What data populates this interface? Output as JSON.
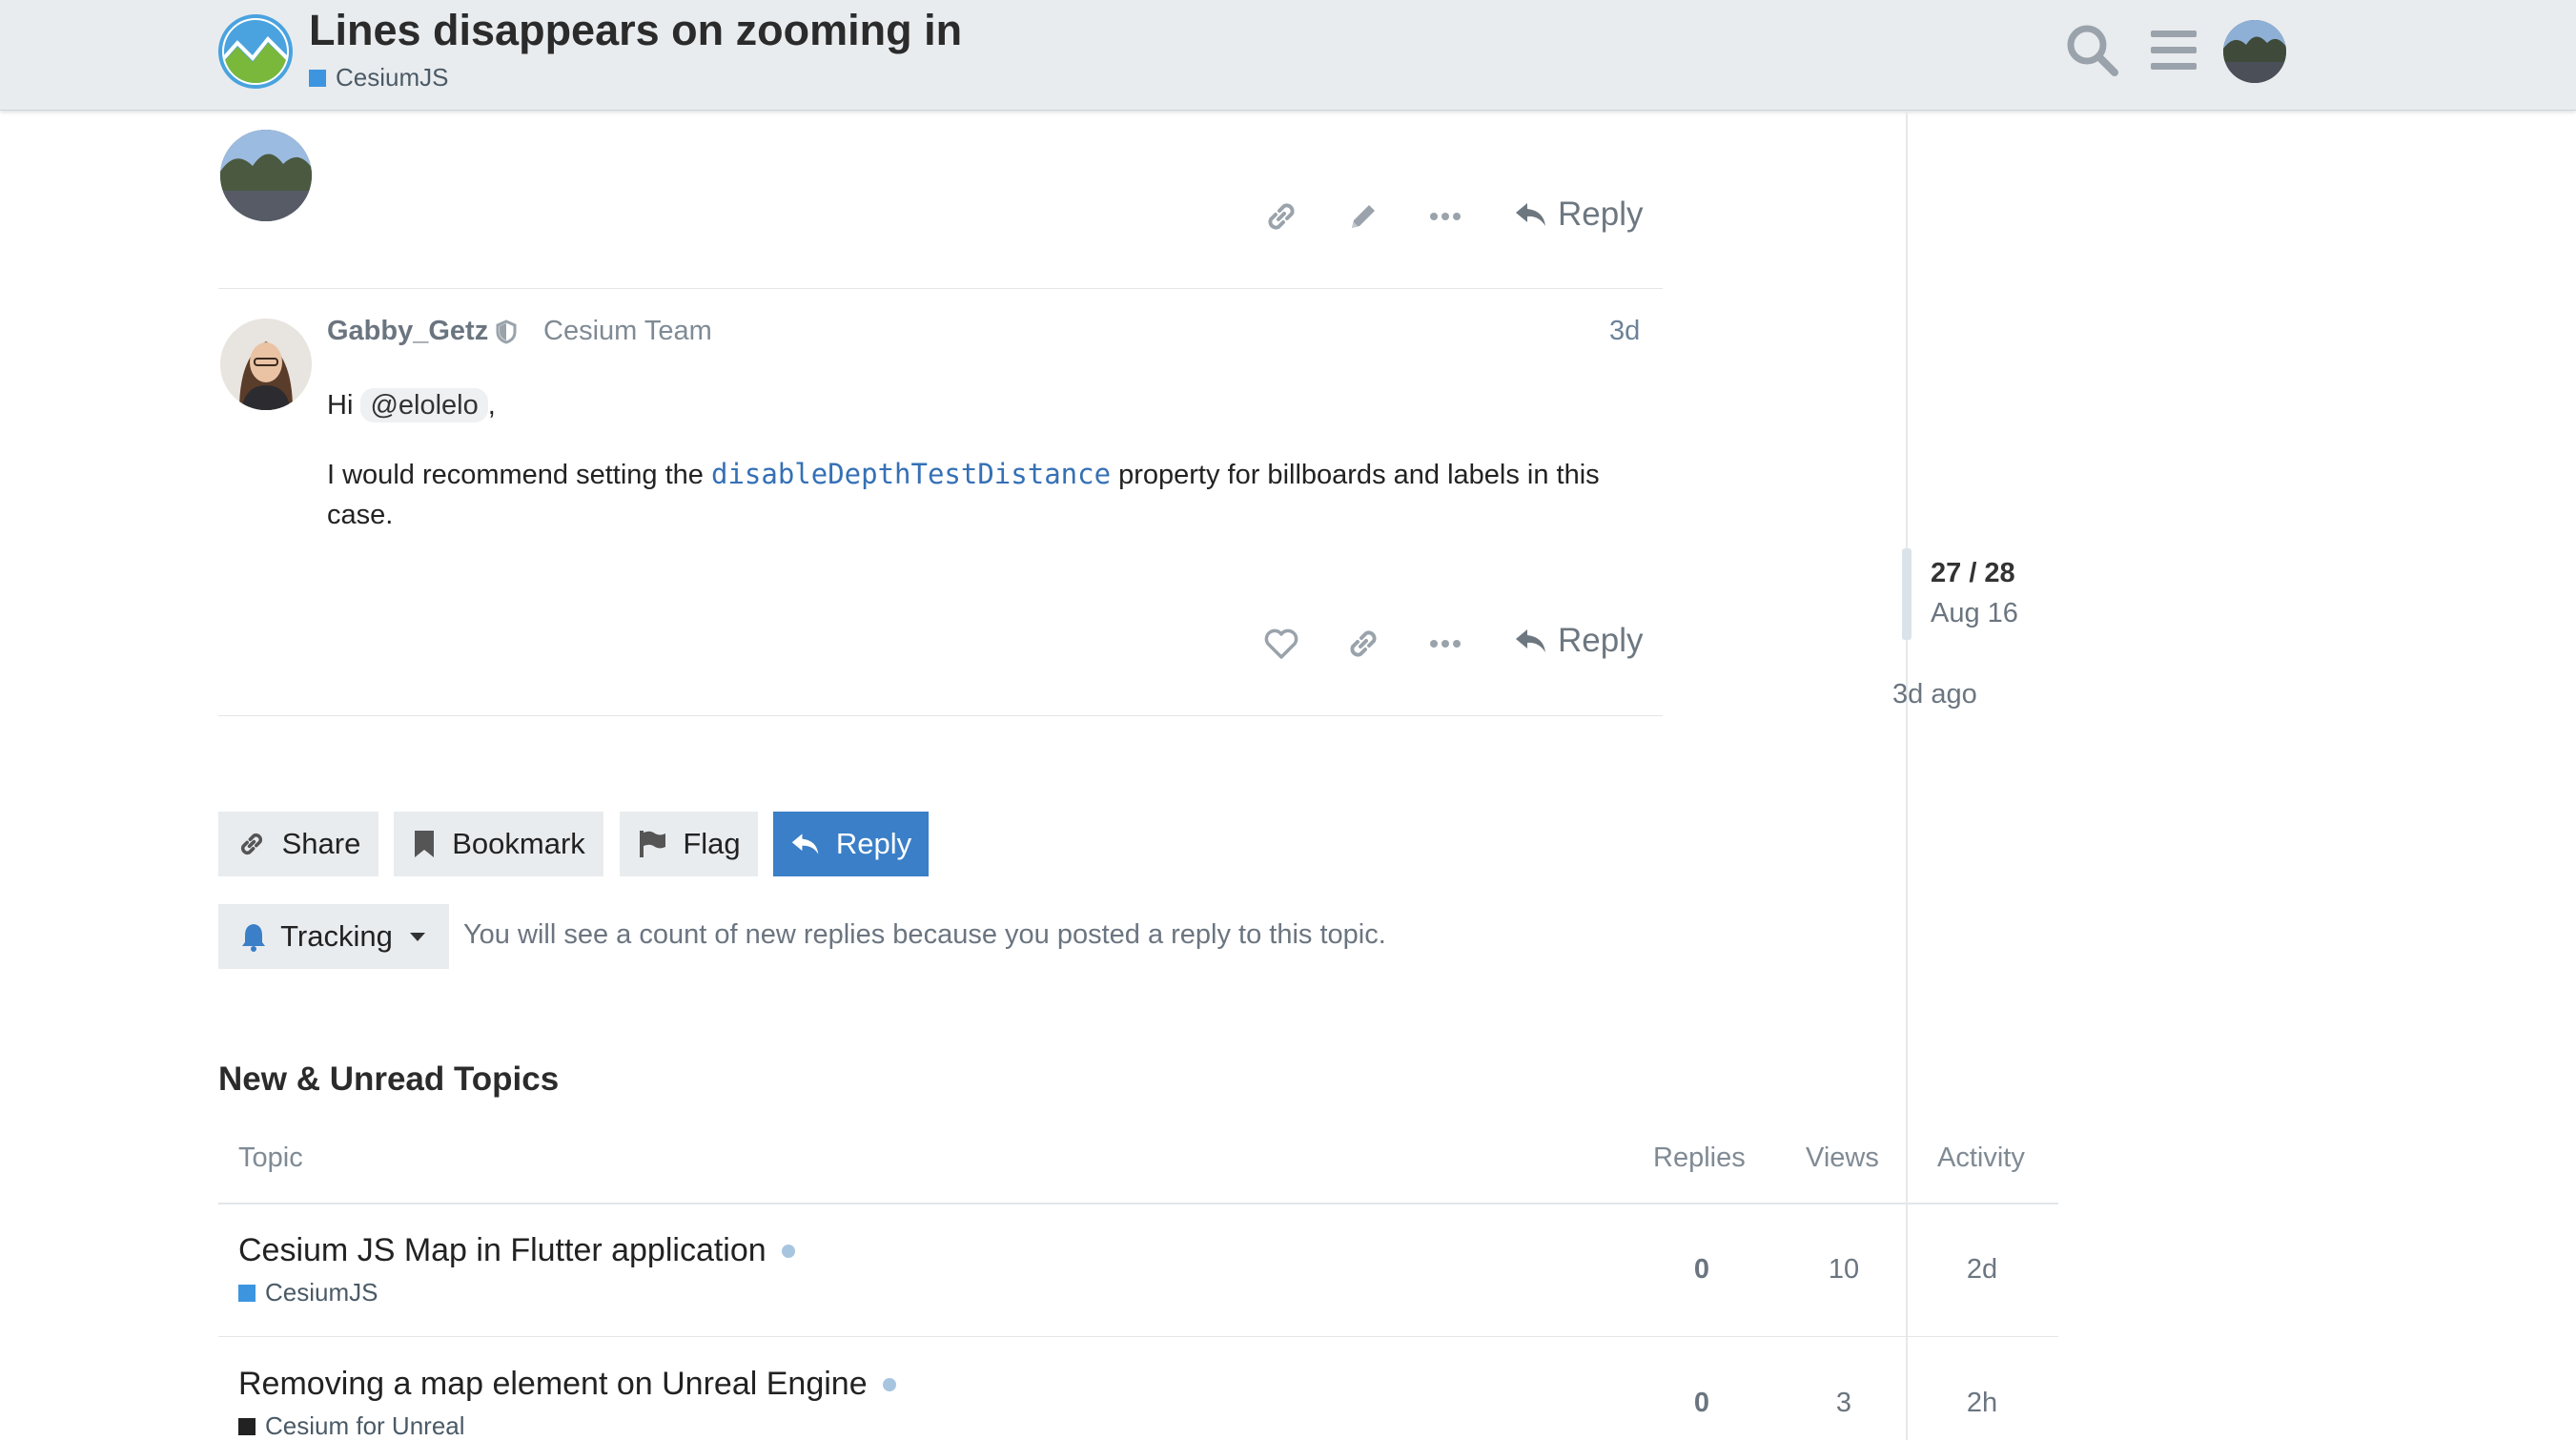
{
  "header": {
    "title": "Lines disappears on zooming in",
    "category": "CesiumJS",
    "category_color": "#3d95e0"
  },
  "timeline": {
    "count": "27 / 28",
    "date": "Aug 16",
    "ago": "3d ago"
  },
  "previous_post": {
    "reply_label": "Reply"
  },
  "post": {
    "username": "Gabby_Getz",
    "user_title": "Cesium Team",
    "date": "3d",
    "greeting": "Hi",
    "mention": "@elolelo",
    "after_mention": ",",
    "text_before_code": "I would recommend setting the",
    "code": "disableDepthTestDistance",
    "text_after_code": "property for billboards and labels in this case.",
    "reply_label": "Reply"
  },
  "footer_buttons": {
    "share": "Share",
    "bookmark": "Bookmark",
    "flag": "Flag",
    "reply": "Reply"
  },
  "notifications": {
    "level": "Tracking",
    "note": "You will see a count of new replies because you posted a reply to this topic."
  },
  "topics": {
    "heading": "New & Unread Topics",
    "columns": [
      "Topic",
      "Replies",
      "Views",
      "Activity"
    ],
    "rows": [
      {
        "title": "Cesium JS Map in Flutter application",
        "category": "CesiumJS",
        "category_color": "#3d95e0",
        "replies": "0",
        "views": "10",
        "activity": "2d"
      },
      {
        "title": "Removing a map element on Unreal Engine",
        "category": "Cesium for Unreal",
        "category_color": "#222222",
        "replies": "0",
        "views": "3",
        "activity": "2h"
      }
    ]
  },
  "colors": {
    "accent": "#3a7fc7",
    "header_bg": "#e9ecef"
  },
  "icons": [
    "logo-icon",
    "search-icon",
    "menu-icon",
    "link-icon",
    "pencil-icon",
    "more-icon",
    "reply-icon",
    "shield-icon",
    "heart-icon",
    "bookmark-icon",
    "flag-icon",
    "bell-icon",
    "caret-down-icon"
  ]
}
